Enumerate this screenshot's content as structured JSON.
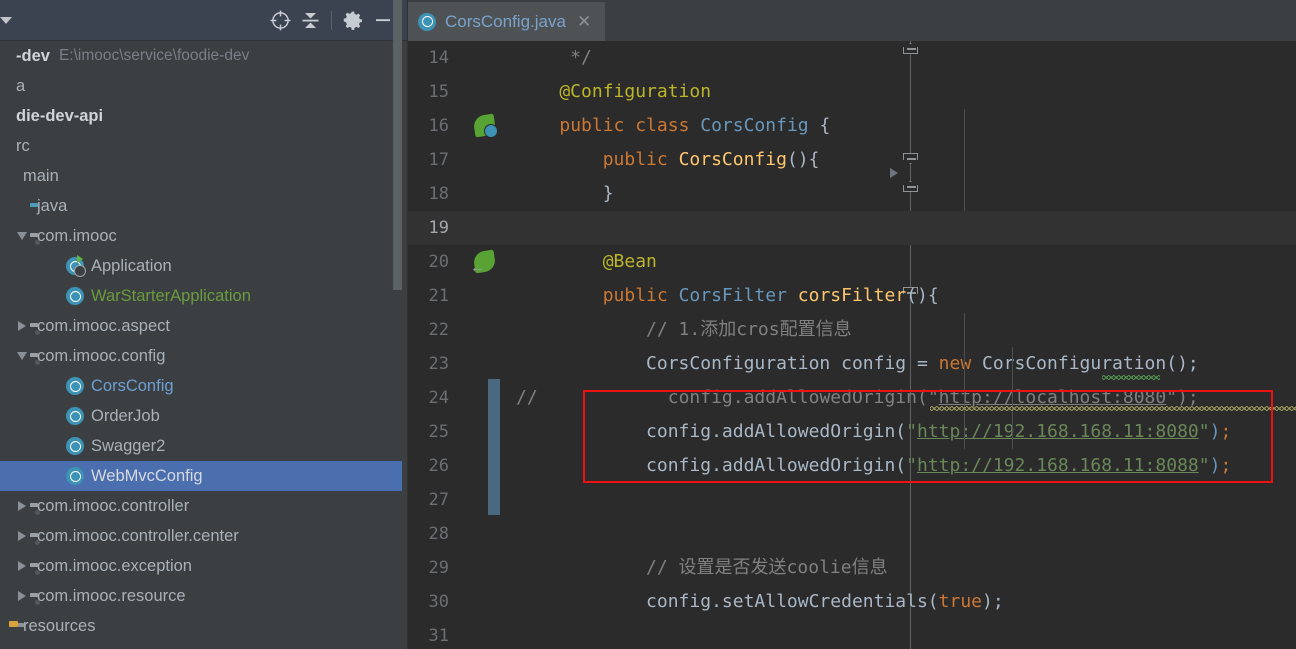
{
  "project_panel": {
    "header": {
      "caret_icon": "chevron-down-icon",
      "tools": [
        {
          "name": "scroll-from-source-icon",
          "label": "crosshair-target-icon"
        },
        {
          "name": "collapse-all-icon",
          "label": "collapse-all-icon"
        },
        {
          "name": "settings-gear-icon",
          "label": "gear-icon"
        },
        {
          "name": "hide-panel-icon",
          "label": "minus-icon"
        }
      ]
    },
    "tree": [
      {
        "id": "foodie-dev",
        "label": "-dev",
        "path": "E:\\imooc\\service\\foodie-dev",
        "indent": 0,
        "bold": true,
        "twisty": "none",
        "icon": "none"
      },
      {
        "id": "idea-folder",
        "label": "a",
        "indent": 0,
        "twisty": "none",
        "icon": "none"
      },
      {
        "id": "foodie-dev-api",
        "label": "die-dev-api",
        "indent": 0,
        "bold": true,
        "twisty": "none",
        "icon": "none"
      },
      {
        "id": "src",
        "label": "rc",
        "indent": 0,
        "twisty": "none",
        "icon": "none"
      },
      {
        "id": "main",
        "label": "main",
        "indent": 0,
        "twisty": "none",
        "icon": "grey-square"
      },
      {
        "id": "java",
        "label": "java",
        "indent": 1,
        "twisty": "none",
        "icon": "source-folder"
      },
      {
        "id": "com-imooc",
        "label": "com.imooc",
        "indent": 1,
        "twisty": "open",
        "icon": "package"
      },
      {
        "id": "application",
        "label": "Application",
        "indent": 3,
        "twisty": "none",
        "icon": "runnable-class"
      },
      {
        "id": "warstarterapplication",
        "label": "WarStarterApplication",
        "indent": 3,
        "twisty": "none",
        "icon": "class",
        "color": "green"
      },
      {
        "id": "com-imooc-aspect",
        "label": "com.imooc.aspect",
        "indent": 1,
        "twisty": "closed",
        "icon": "package"
      },
      {
        "id": "com-imooc-config",
        "label": "com.imooc.config",
        "indent": 1,
        "twisty": "open",
        "icon": "package"
      },
      {
        "id": "corsconfig",
        "label": "CorsConfig",
        "indent": 3,
        "twisty": "none",
        "icon": "class",
        "color": "blue"
      },
      {
        "id": "orderjob",
        "label": "OrderJob",
        "indent": 3,
        "twisty": "none",
        "icon": "class"
      },
      {
        "id": "swagger2",
        "label": "Swagger2",
        "indent": 3,
        "twisty": "none",
        "icon": "class"
      },
      {
        "id": "webmvcconfig",
        "label": "WebMvcConfig",
        "indent": 3,
        "twisty": "none",
        "icon": "class",
        "selected": true
      },
      {
        "id": "com-imooc-controller",
        "label": "com.imooc.controller",
        "indent": 1,
        "twisty": "closed",
        "icon": "package"
      },
      {
        "id": "com-imooc-controller-center",
        "label": "com.imooc.controller.center",
        "indent": 1,
        "twisty": "closed",
        "icon": "package"
      },
      {
        "id": "com-imooc-exception",
        "label": "com.imooc.exception",
        "indent": 1,
        "twisty": "closed",
        "icon": "package"
      },
      {
        "id": "com-imooc-resource",
        "label": "com.imooc.resource",
        "indent": 1,
        "twisty": "closed",
        "icon": "package"
      },
      {
        "id": "resources",
        "label": "resources",
        "indent": 0,
        "twisty": "none",
        "icon": "resources-folder"
      }
    ]
  },
  "editor": {
    "tab": {
      "label": "CorsConfig.java",
      "icon": "java-class-icon",
      "close_icon": "close-icon",
      "active": true
    },
    "caret_line": 19,
    "lines": [
      {
        "n": 14,
        "segments": [
          {
            "t": "     */",
            "c": "cmt"
          }
        ]
      },
      {
        "n": 15,
        "segments": [
          {
            "t": "    @Configuration",
            "c": "ann"
          }
        ]
      },
      {
        "n": 16,
        "segments": [
          {
            "t": "    ",
            "c": "punc"
          },
          {
            "t": "public class ",
            "c": "kw"
          },
          {
            "t": "CorsConfig ",
            "c": "cls"
          },
          {
            "t": "{",
            "c": "punc"
          }
        ]
      },
      {
        "n": 17,
        "segments": [
          {
            "t": "        ",
            "c": "punc"
          },
          {
            "t": "public ",
            "c": "kw"
          },
          {
            "t": "CorsConfig",
            "c": "mth"
          },
          {
            "t": "(){",
            "c": "punc"
          }
        ]
      },
      {
        "n": 18,
        "segments": [
          {
            "t": "        }",
            "c": "punc"
          }
        ]
      },
      {
        "n": 19,
        "segments": []
      },
      {
        "n": 20,
        "segments": [
          {
            "t": "        @Bean",
            "c": "ann"
          }
        ]
      },
      {
        "n": 21,
        "segments": [
          {
            "t": "        ",
            "c": "punc"
          },
          {
            "t": "public ",
            "c": "kw"
          },
          {
            "t": "CorsFilter ",
            "c": "cls"
          },
          {
            "t": "corsFilter",
            "c": "mth"
          },
          {
            "t": "(){",
            "c": "punc"
          }
        ]
      },
      {
        "n": 22,
        "segments": [
          {
            "t": "            // 1.添加cros配置信息",
            "c": "cmt"
          }
        ]
      },
      {
        "n": 23,
        "segments": [
          {
            "t": "            CorsConfiguration config = ",
            "c": "type"
          },
          {
            "t": "new ",
            "c": "kw"
          },
          {
            "t": "CorsConfiguration",
            "c": "type"
          },
          {
            "t": "();",
            "c": "punc"
          }
        ]
      },
      {
        "n": 24,
        "segments": [
          {
            "t": "//",
            "c": "cmt"
          },
          {
            "t": "            config.addAllowedOrigin(\"",
            "c": "cmt"
          },
          {
            "t": "http://localhost:8080",
            "c": "cmtlink"
          },
          {
            "t": "\");",
            "c": "cmt"
          }
        ]
      },
      {
        "n": 25,
        "segments": [
          {
            "t": "            config.addAllowedOrigin(",
            "c": "type"
          },
          {
            "t": "\"",
            "c": "str"
          },
          {
            "t": "http://192.168.168.11:8080",
            "c": "strlink"
          },
          {
            "t": "\"",
            "c": "str"
          },
          {
            "t": ")",
            "c": "cls"
          },
          {
            "t": ";",
            "c": "semi"
          }
        ]
      },
      {
        "n": 26,
        "segments": [
          {
            "t": "            config.addAllowedOrigin(",
            "c": "type"
          },
          {
            "t": "\"",
            "c": "str"
          },
          {
            "t": "http://192.168.168.11:8088",
            "c": "strlink"
          },
          {
            "t": "\"",
            "c": "str"
          },
          {
            "t": ")",
            "c": "cls"
          },
          {
            "t": ";",
            "c": "semi"
          }
        ]
      },
      {
        "n": 27,
        "segments": []
      },
      {
        "n": 28,
        "segments": []
      },
      {
        "n": 29,
        "segments": [
          {
            "t": "            // 设置是否发送coolie信息",
            "c": "cmt"
          }
        ]
      },
      {
        "n": 30,
        "segments": [
          {
            "t": "            config.setAllowCredentials(",
            "c": "type"
          },
          {
            "t": "true",
            "c": "kw"
          },
          {
            "t": ");",
            "c": "punc"
          }
        ]
      },
      {
        "n": 31,
        "segments": []
      }
    ],
    "gutter_icons": [
      {
        "line": 16,
        "name": "spring-bean-class-icon"
      },
      {
        "line": 20,
        "name": "spring-bean-method-icon"
      }
    ],
    "annotation": {
      "name": "red-highlight-box",
      "color": "#ee1111",
      "lines": [
        24,
        25,
        26
      ]
    }
  },
  "colors": {
    "panel_header_bg": "#3c4350",
    "panel_bg": "#3c3f41",
    "editor_bg": "#2b2b2b",
    "selection_blue": "#4b6eaf",
    "annotation_red": "#ee1111",
    "tab_text": "#7aa2cc",
    "string_green": "#6a8759",
    "annotation_yellow": "#bbb529",
    "keyword_orange": "#cc7832"
  }
}
